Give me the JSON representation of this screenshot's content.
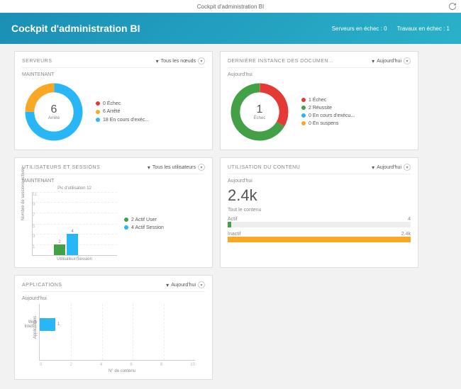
{
  "topbar": {
    "title": "Cockpit d'administration BI"
  },
  "header": {
    "title": "Cockpit d'administration BI",
    "stat1_label": "Serveurs en échec :",
    "stat1_val": "0",
    "stat2_label": "Travaux en échec :",
    "stat2_val": "1"
  },
  "cards": {
    "servers": {
      "title": "SERVEURS",
      "filter": "Tous les nœuds",
      "sub": "MAINTENANT",
      "center_num": "6",
      "center_lbl": "Arrêté",
      "legend": [
        {
          "color": "#e53935",
          "text": "0 Échec"
        },
        {
          "color": "#f9a825",
          "text": "6 Arrêté"
        },
        {
          "color": "#29b6f6",
          "text": "18 En cours d'exéc..."
        }
      ]
    },
    "docs": {
      "title": "DERNIÈRE INSTANCE DES DOCUMEN...",
      "filter": "Aujourd'hui",
      "sub": "Aujourd'hui",
      "center_num": "1",
      "center_lbl": "Échec",
      "legend": [
        {
          "color": "#e53935",
          "text": "1 Échec"
        },
        {
          "color": "#43a047",
          "text": "2 Réussite"
        },
        {
          "color": "#29b6f6",
          "text": "0 En cours d'exécu..."
        },
        {
          "color": "#f9a825",
          "text": "0 En suspens"
        }
      ]
    },
    "users": {
      "title": "UTILISATEURS ET SESSIONS",
      "filter": "Tous les utilisateurs",
      "sub": "MAINTENANT",
      "peak": "Pic d'utilisation 12",
      "ylabel": "Nombre de sessions actives",
      "xlabel": "Utilisateur/Session",
      "yticks": [
        "1",
        "3",
        "5",
        "7",
        "9",
        "11"
      ],
      "legend": [
        {
          "color": "#43a047",
          "text": "2 Actif User"
        },
        {
          "color": "#29b6f6",
          "text": "4 Actif Session"
        }
      ]
    },
    "content": {
      "title": "UTILISATION DU CONTENU",
      "filter": "Aujourd'hui",
      "sub": "Aujourd'hui",
      "bignum": "2.4k",
      "bigsub": "Tout le contenu",
      "rows": [
        {
          "label": "Actif",
          "val": "4",
          "fill": "#43a047",
          "pct": 2
        },
        {
          "label": "Inactif",
          "val": "2.4k",
          "fill": "#f9a825",
          "pct": 100
        }
      ]
    },
    "apps": {
      "title": "APPLICATIONS",
      "filter": "Aujourd'hui",
      "sub": "Aujourd'hui",
      "ylabel": "Applications",
      "xlabel": "N° de contenu",
      "cat": "Web Intell...",
      "val": "1",
      "ticks": [
        "0",
        "2",
        "4",
        "6",
        "8",
        "10"
      ]
    }
  },
  "chart_data": [
    {
      "type": "pie",
      "title": "SERVEURS — MAINTENANT",
      "series": [
        {
          "name": "Échec",
          "value": 0,
          "color": "#e53935"
        },
        {
          "name": "Arrêté",
          "value": 6,
          "color": "#f9a825"
        },
        {
          "name": "En cours d'exécution",
          "value": 18,
          "color": "#29b6f6"
        }
      ]
    },
    {
      "type": "pie",
      "title": "DERNIÈRE INSTANCE DES DOCUMENTS — Aujourd'hui",
      "series": [
        {
          "name": "Échec",
          "value": 1,
          "color": "#e53935"
        },
        {
          "name": "Réussite",
          "value": 2,
          "color": "#43a047"
        },
        {
          "name": "En cours d'exécution",
          "value": 0,
          "color": "#29b6f6"
        },
        {
          "name": "En suspens",
          "value": 0,
          "color": "#f9a825"
        }
      ]
    },
    {
      "type": "bar",
      "title": "UTILISATEURS ET SESSIONS — MAINTENANT",
      "categories": [
        "Utilisateur",
        "Session"
      ],
      "values": [
        2,
        4
      ],
      "ylabel": "Nombre de sessions actives",
      "ylim": [
        0,
        12
      ],
      "annotation": "Pic d'utilisation 12"
    },
    {
      "type": "bar",
      "title": "UTILISATION DU CONTENU — Aujourd'hui",
      "categories": [
        "Actif",
        "Inactif"
      ],
      "values": [
        4,
        2400
      ],
      "orientation": "horizontal"
    },
    {
      "type": "bar",
      "title": "APPLICATIONS — Aujourd'hui",
      "categories": [
        "Web Intelligence"
      ],
      "values": [
        1
      ],
      "xlabel": "N° de contenu",
      "xlim": [
        0,
        10
      ],
      "orientation": "horizontal"
    }
  ]
}
